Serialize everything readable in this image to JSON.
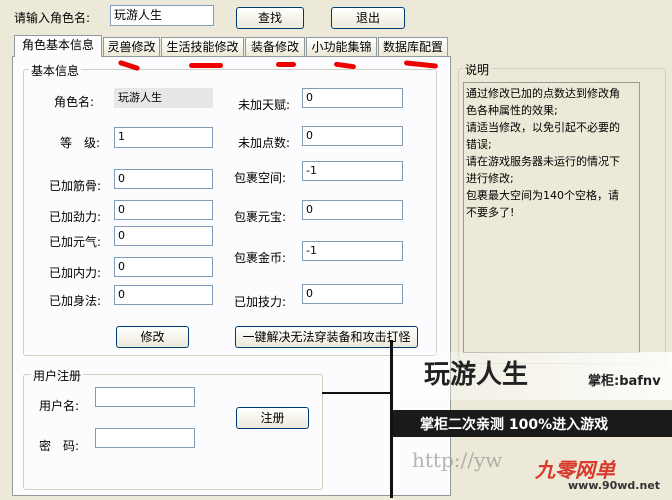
{
  "top": {
    "role_label": "请输入角色名:",
    "role_value": "玩游人生",
    "search_label": "查找",
    "exit_label": "退出"
  },
  "tabs": [
    {
      "label": "角色基本信息"
    },
    {
      "label": "灵兽修改"
    },
    {
      "label": "生活技能修改"
    },
    {
      "label": "装备修改"
    },
    {
      "label": "小功能集锦"
    },
    {
      "label": "数据库配置"
    }
  ],
  "basic": {
    "title": "基本信息",
    "name_label": "角色名:",
    "name_value": "玩游人生",
    "level_label": "等　级:",
    "level_value": "1",
    "jingu_label": "已加筋骨:",
    "jingu_value": "0",
    "jinli_label": "已加劲力:",
    "jinli_value": "0",
    "yuanqi_label": "已加元气:",
    "yuanqi_value": "0",
    "neili_label": "已加内力:",
    "neili_value": "0",
    "shenfa_label": "已加身法:",
    "shenfa_value": "0",
    "tianfu_label": "未加天赋:",
    "tianfu_value": "0",
    "dianshu_label": "未加点数:",
    "dianshu_value": "0",
    "bag_space_label": "包裹空间:",
    "bag_space_value": "-1",
    "bag_yuanbao_label": "包裹元宝:",
    "bag_yuanbao_value": "0",
    "bag_gold_label": "包裹金币:",
    "bag_gold_value": "-1",
    "jineng_label": "已加技力:",
    "jineng_value": "0",
    "modify_label": "修改",
    "fix_label": "一键解决无法穿装备和攻击打怪"
  },
  "register": {
    "title": "用户注册",
    "user_label": "用户名:",
    "user_value": "",
    "pwd_label": "密　码:",
    "pwd_value": "",
    "submit_label": "注册"
  },
  "help": {
    "title": "说明",
    "lines": [
      "通过修改已加的点数达到修改角",
      "色各种属性的效果;",
      "请适当修改，以免引起不必要的",
      "错误;",
      "请在游戏服务器未运行的情况下",
      "进行修改;",
      "包裹最大空间为140个空格，请",
      "不要多了!"
    ]
  },
  "watermark": {
    "title": "玩游人生",
    "owner": "掌柜:bafnv",
    "slogan": "掌柜二次亲测  100%进入游戏",
    "url_partial": "http://yw",
    "brand": "九零网单",
    "brand_url": "www.90wd.net"
  }
}
